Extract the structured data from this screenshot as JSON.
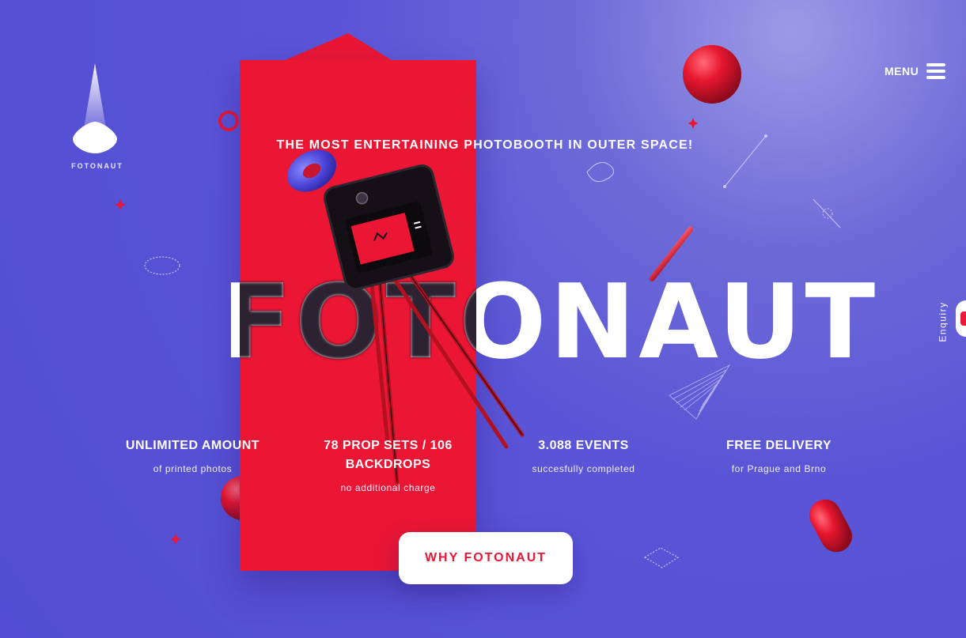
{
  "brand": {
    "logo_text": "FOTONAUT"
  },
  "nav": {
    "menu_label": "MENU",
    "enquiry_label": "Enquiry"
  },
  "hero": {
    "tagline": "THE MOST ENTERTAINING PHOTOBOOTH IN OUTER SPACE!",
    "title": "FOTONAUT",
    "cta_label": "WHY FOTONAUT"
  },
  "features": [
    {
      "title": "UNLIMITED AMOUNT",
      "subtitle": "of printed photos"
    },
    {
      "title": "78 PROP SETS / 106 BACKDROPS",
      "subtitle": "no additional charge"
    },
    {
      "title": "3.088 EVENTS",
      "subtitle": "succesfully completed"
    },
    {
      "title": "FREE DELIVERY",
      "subtitle": "for Prague and Brno"
    }
  ],
  "colors": {
    "background": "#524dd2",
    "accent_red": "#ea1634",
    "white": "#ffffff",
    "dark": "#1b1020"
  },
  "icons": [
    "rocket-logo-icon",
    "hamburger-menu-icon",
    "photobooth-illustration",
    "decorative-shapes"
  ]
}
